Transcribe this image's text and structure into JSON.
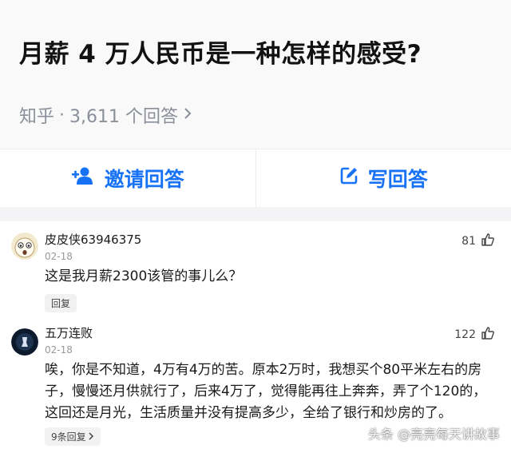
{
  "question": {
    "title": "月薪 4 万人民币是一种怎样的感受?",
    "source": "知乎",
    "separator": "·",
    "answer_count": "3,611 个回答"
  },
  "actions": {
    "invite_label": "邀请回答",
    "write_label": "写回答"
  },
  "comments": [
    {
      "author": "皮皮侠63946375",
      "date": "02-18",
      "likes": "81",
      "text": "这是我月薪2300该管的事儿么？",
      "reply_label": "回复"
    },
    {
      "author": "五万连败",
      "date": "02-18",
      "likes": "122",
      "text": "唉，你是不知道，4万有4万的苦。原本2万时，我想买个80平米左右的房子，慢慢还月供就行了，后来4万了，觉得能再往上奔奔，弄了个120的，这回还是月光，生活质量并没有提高多少，全给了银行和炒房的了。",
      "reply_label": "9条回复"
    }
  ],
  "watermark": "头条 @亮亮每天讲故事",
  "colors": {
    "accent": "#1772f6",
    "muted": "#8a8f99"
  }
}
